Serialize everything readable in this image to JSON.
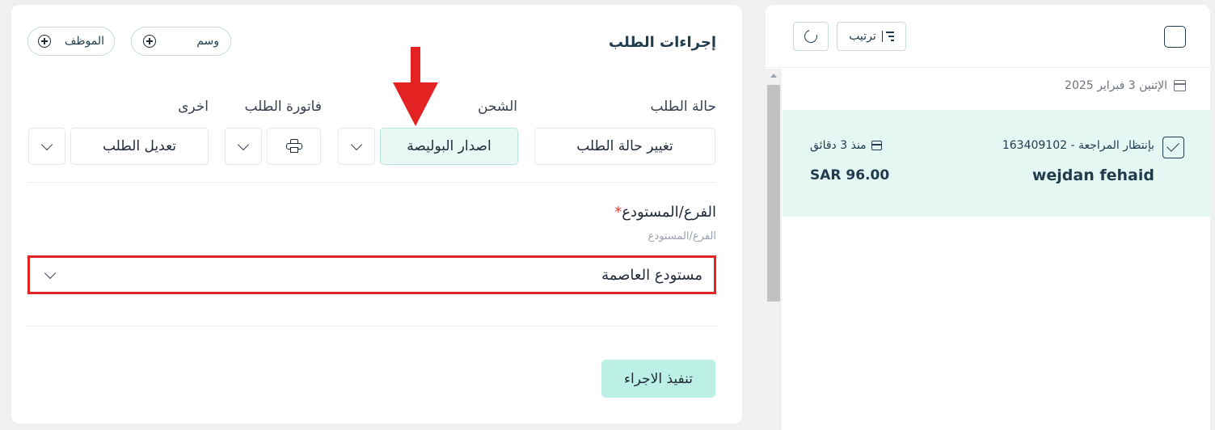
{
  "actions": {
    "title": "إجراءات الطلب",
    "employee_label": "الموظف",
    "tag_label": "وسم",
    "groups": {
      "status_label": "حالة الطلب",
      "shipping_label": "الشحن",
      "invoice_label": "فاتورة الطلب",
      "other_label": "اخرى"
    },
    "buttons": {
      "change_status": "تغيير حالة الطلب",
      "issue_waybill": "اصدار البوليصة",
      "edit_order": "تعديل الطلب",
      "execute": "تنفيذ الاجراء"
    },
    "branch_field": {
      "label": "الفرع/المستودع",
      "required_mark": "*",
      "hint": "الفرع/المستودع",
      "selected": "مستودع العاصمة"
    }
  },
  "list": {
    "sort_label": "ترتيب",
    "date": "الإثنين 3 فبراير 2025",
    "order": {
      "status_id": "بإنتظار المراجعة - 163409102",
      "customer": "wejdan fehaid",
      "time_ago": "منذ 3 دقائق",
      "amount": "SAR 96.00"
    }
  },
  "colors": {
    "accent_bg": "#eaf8f5",
    "execute_bg": "#bdf0e4",
    "card_bg": "#e4f7f2",
    "highlight_red": "#e02424",
    "text_primary": "#1f3b4d"
  }
}
